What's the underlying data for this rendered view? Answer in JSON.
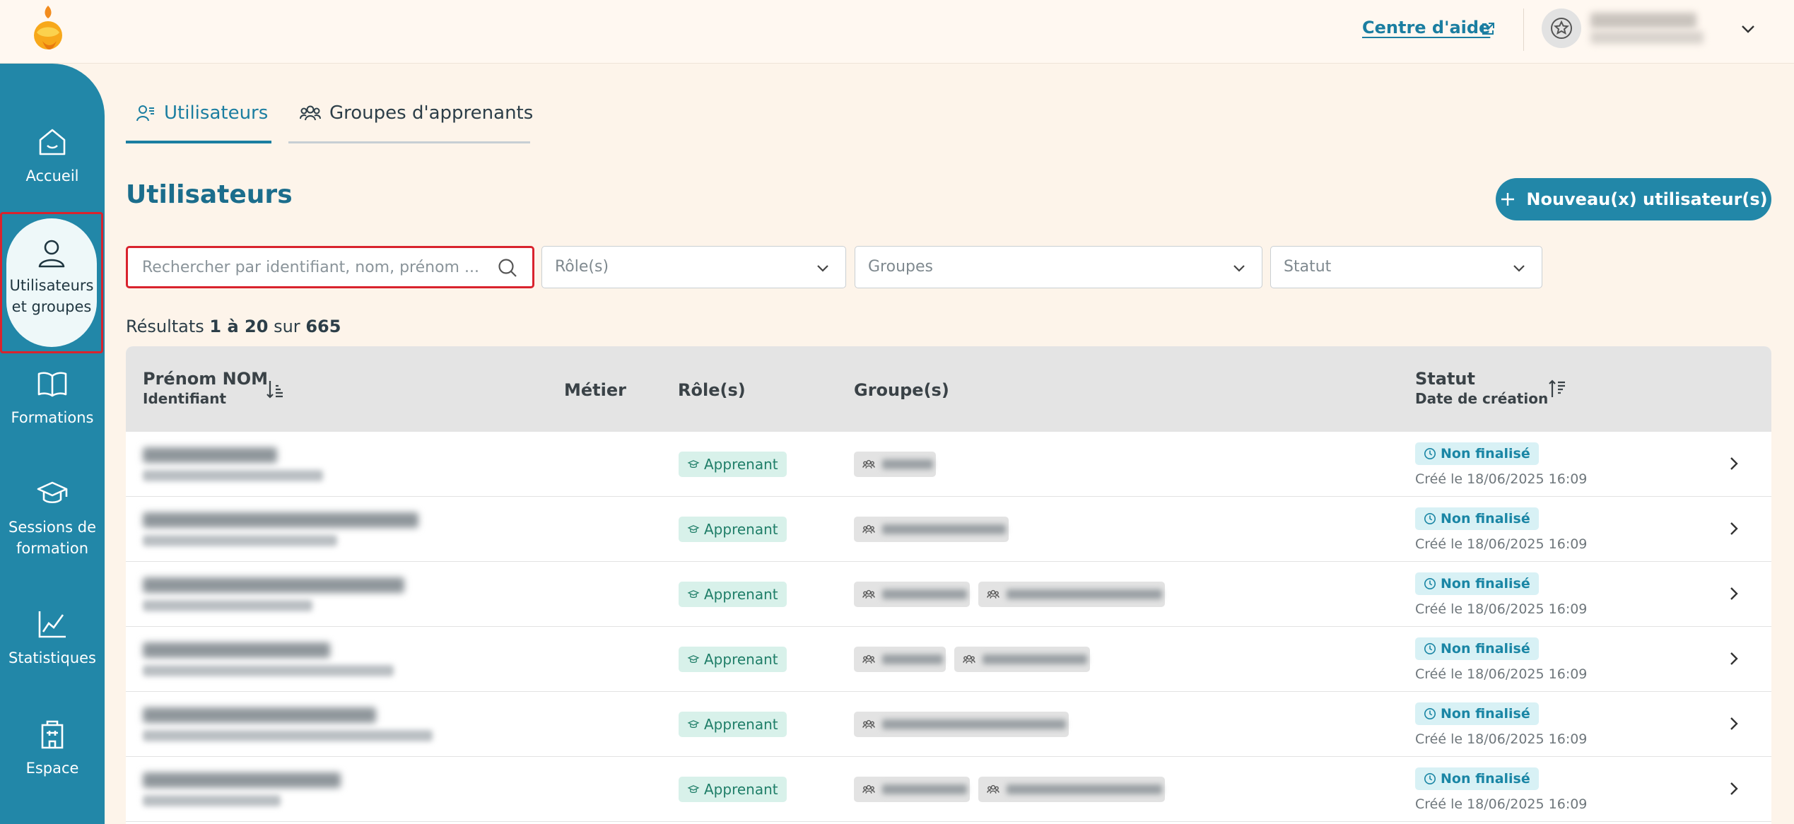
{
  "header": {
    "help_label": "Centre d'aide"
  },
  "sidebar": {
    "items": [
      {
        "label": "Accueil",
        "icon": "home-icon"
      },
      {
        "label": "Utilisateurs et groupes",
        "icon": "user-icon",
        "active": true
      },
      {
        "label": "Formations",
        "icon": "book-icon"
      },
      {
        "label": "Sessions de formation",
        "icon": "graduation-cap-icon"
      },
      {
        "label": "Statistiques",
        "icon": "chart-line-icon"
      },
      {
        "label": "Espace",
        "icon": "building-icon"
      }
    ]
  },
  "tabs": [
    {
      "label": "Utilisateurs",
      "active": true
    },
    {
      "label": "Groupes d'apprenants",
      "active": false
    }
  ],
  "page": {
    "title": "Utilisateurs",
    "new_button_label": "Nouveau(x) utilisateur(s)"
  },
  "filters": {
    "search_placeholder": "Rechercher par identifiant, nom, prénom ...",
    "role_placeholder": "Rôle(s)",
    "groups_placeholder": "Groupes",
    "status_placeholder": "Statut"
  },
  "results": {
    "prefix": "Résultats",
    "range": "1 à 20",
    "sep": "sur",
    "total": "665"
  },
  "table": {
    "columns": {
      "name": "Prénom NOM",
      "name_sub": "Identifiant",
      "job": "Métier",
      "roles": "Rôle(s)",
      "groups": "Groupe(s)",
      "status": "Statut",
      "status_sub": "Date de création"
    },
    "rows": [
      {
        "role": "Apprenant",
        "status": "Non finalisé",
        "created": "Créé le 18/06/2025 16:09"
      },
      {
        "role": "Apprenant",
        "status": "Non finalisé",
        "created": "Créé le 18/06/2025 16:09"
      },
      {
        "role": "Apprenant",
        "status": "Non finalisé",
        "created": "Créé le 18/06/2025 16:09"
      },
      {
        "role": "Apprenant",
        "status": "Non finalisé",
        "created": "Créé le 18/06/2025 16:09"
      },
      {
        "role": "Apprenant",
        "status": "Non finalisé",
        "created": "Créé le 18/06/2025 16:09"
      },
      {
        "role": "Apprenant",
        "status": "Non finalisé",
        "created": "Créé le 18/06/2025 16:09"
      }
    ]
  },
  "colors": {
    "primary": "#2287a8",
    "title": "#1b6d8c",
    "page_bg": "#fdf4ea",
    "highlight": "#d9232d",
    "role_badge_bg": "#d8f1ea",
    "status_badge_bg": "#d8f1f5"
  }
}
